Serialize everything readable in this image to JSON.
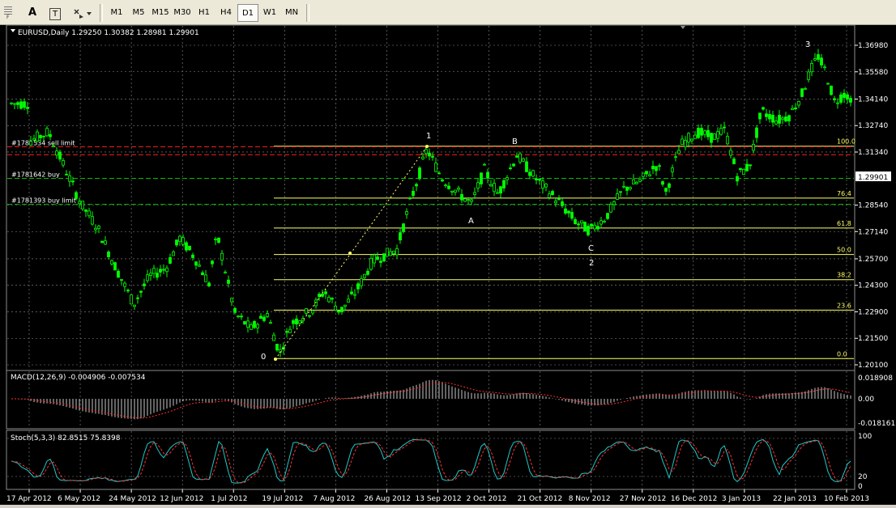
{
  "toolbar": {
    "tools": [
      {
        "name": "text-tool",
        "label": "A"
      },
      {
        "name": "text-label-tool",
        "label": "T"
      }
    ],
    "timeframes": [
      "M1",
      "M5",
      "M15",
      "M30",
      "H1",
      "H4",
      "D1",
      "W1",
      "MN"
    ],
    "active_timeframe": "D1"
  },
  "main_panel": {
    "header": "EURUSD,Daily  1.29250 1.30382 1.28981 1.29901",
    "price_axis_ticks": [
      "1.36980",
      "1.35580",
      "1.34140",
      "1.32740",
      "1.31340",
      "1.29901",
      "1.28540",
      "1.27140",
      "1.25700",
      "1.24300",
      "1.22900",
      "1.21500",
      "1.20100"
    ],
    "current_price": "1.29901",
    "order_lines": [
      {
        "label": "#1781534 sell limit",
        "price": 1.3162,
        "color": "#ff2020"
      },
      {
        "label": "",
        "price": 1.312,
        "color": "#ff2020"
      },
      {
        "label": "#1781642 buy",
        "price": 1.2995,
        "color": "#00c000"
      },
      {
        "label": "#1781393 buy limit",
        "price": 1.2858,
        "color": "#00c000"
      }
    ],
    "fibonacci": [
      {
        "label": "100.0",
        "price": 1.3165
      },
      {
        "label": "76.4",
        "price": 1.2891
      },
      {
        "label": "61.8",
        "price": 1.2733
      },
      {
        "label": "50.0",
        "price": 1.2593
      },
      {
        "label": "38.2",
        "price": 1.246
      },
      {
        "label": "23.6",
        "price": 1.2299
      },
      {
        "label": "0.0",
        "price": 1.2043
      }
    ],
    "wave_labels": [
      "0",
      "1",
      "B",
      "A",
      "C",
      "2",
      "3"
    ],
    "colors": {
      "bull": "#00ff00",
      "bear": "#ffffff",
      "grid": "#8c8c8c",
      "fib": "#ffff66",
      "up_candle_body": "#000000"
    }
  },
  "macd_panel": {
    "header": "MACD(12,26,9) -0.004906 -0.007534",
    "ticks": [
      "0.018908",
      "0.00",
      "-0.018161"
    ]
  },
  "stoch_panel": {
    "header": "Stoch(5,3,3) 82.8515 75.8398",
    "ticks": [
      "100",
      "20",
      "0"
    ]
  },
  "time_axis": [
    "17 Apr 2012",
    "6 May 2012",
    "24 May 2012",
    "12 Jun 2012",
    "1 Jul 2012",
    "19 Jul 2012",
    "7 Aug 2012",
    "26 Aug 2012",
    "13 Sep 2012",
    "2 Oct 2012",
    "21 Oct 2012",
    "8 Nov 2012",
    "27 Nov 2012",
    "16 Dec 2012",
    "3 Jan 2013",
    "22 Jan 2013",
    "10 Feb 2013"
  ],
  "chart_data": {
    "type": "candlestick",
    "symbol": "EURUSD",
    "timeframe": "Daily",
    "ylim": [
      1.201,
      1.3698
    ],
    "x": [
      "17 Apr 2012",
      "6 May 2012",
      "24 May 2012",
      "12 Jun 2012",
      "1 Jul 2012",
      "19 Jul 2012",
      "7 Aug 2012",
      "26 Aug 2012",
      "13 Sep 2012",
      "2 Oct 2012",
      "21 Oct 2012",
      "8 Nov 2012",
      "27 Nov 2012",
      "16 Dec 2012",
      "3 Jan 2013",
      "22 Jan 2013",
      "10 Feb 2013"
    ],
    "close": [
      1.317,
      1.3,
      1.25,
      1.265,
      1.238,
      1.218,
      1.234,
      1.255,
      1.305,
      1.296,
      1.294,
      1.278,
      1.296,
      1.32,
      1.306,
      1.358,
      1.34
    ],
    "last": 1.29901
  }
}
